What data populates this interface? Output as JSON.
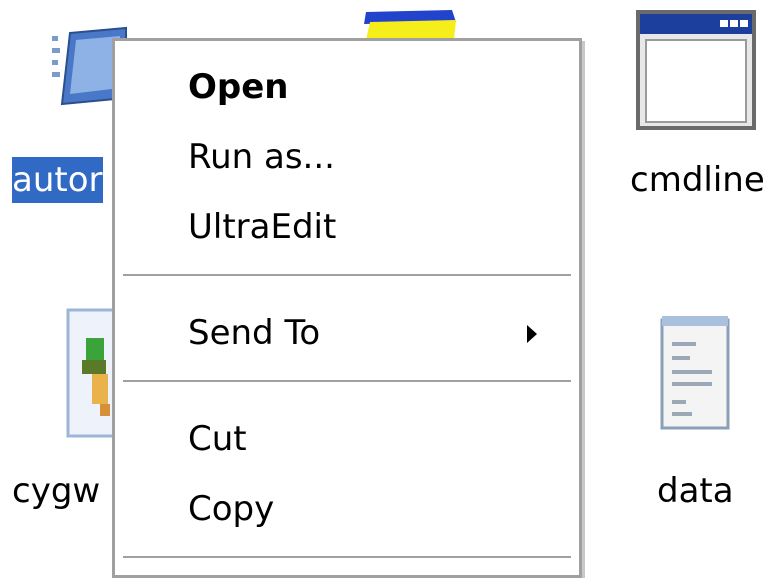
{
  "desktop": {
    "icons": [
      {
        "label": "autor",
        "name": "automation-icon"
      },
      {
        "label": "cmdline",
        "name": "cmdline-icon"
      },
      {
        "label": "cygw",
        "name": "cygwin-icon"
      },
      {
        "label": "data",
        "name": "data-file-icon"
      }
    ]
  },
  "context_menu": {
    "items": [
      {
        "label": "Open"
      },
      {
        "label": "Run as..."
      },
      {
        "label": "UltraEdit"
      },
      {
        "label": "Send To"
      },
      {
        "label": "Cut"
      },
      {
        "label": "Copy"
      }
    ]
  },
  "colors": {
    "selection": "#316ac5",
    "menu_border": "#a0a0a0"
  }
}
